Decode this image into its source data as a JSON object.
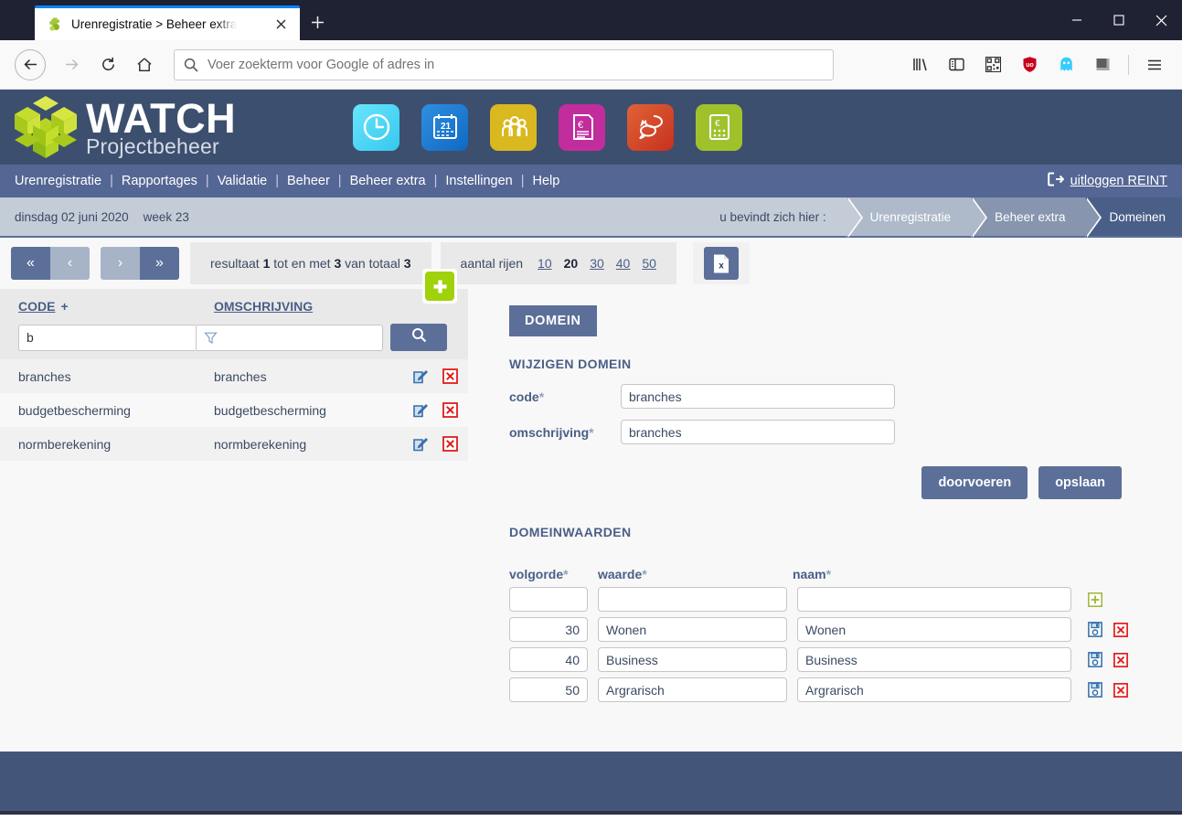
{
  "browser": {
    "tab": {
      "title": "Urenregistratie > Beheer extra",
      "favicon_icon": "puzzle-green-icon",
      "close_icon": "close-icon"
    },
    "new_tab_icon": "plus-icon",
    "window_controls": {
      "minimize": "minimize-icon",
      "maximize": "maximize-icon",
      "close": "close-icon"
    },
    "nav": {
      "back_icon": "arrow-left-icon",
      "forward_icon": "arrow-right-icon",
      "reload_icon": "reload-icon",
      "home_icon": "home-icon"
    },
    "urlbar": {
      "placeholder": "Voer zoekterm voor Google of adres in",
      "value": "",
      "search_icon": "search-icon"
    },
    "toolbar_icons": [
      "library-icon",
      "sidebar-icon",
      "qr-reader-icon",
      "ublock-shield-icon",
      "ghostery-icon",
      "color-swatch-icon",
      "hamburger-menu-icon"
    ]
  },
  "app": {
    "logo": {
      "title": "WATCH",
      "subtitle": "Projectbeheer",
      "mark_icon": "watch-cube-logo-icon"
    },
    "quick_icons": [
      {
        "name": "clock-icon",
        "color": "#4fd7f5"
      },
      {
        "name": "calendar-21-icon",
        "color": "#1b7fd4"
      },
      {
        "name": "people-icon",
        "color": "#d6b317"
      },
      {
        "name": "invoice-euro-icon",
        "color": "#bf2a9a"
      },
      {
        "name": "chat-bubbles-icon",
        "color": "#d1482a"
      },
      {
        "name": "calculator-euro-icon",
        "color": "#a5c62c"
      }
    ],
    "menu": {
      "items": [
        "Urenregistratie",
        "Rapportages",
        "Validatie",
        "Beheer",
        "Beheer extra",
        "Instellingen",
        "Help"
      ],
      "separator": "|",
      "logout": {
        "label": "uitloggen REINT",
        "icon": "logout-icon"
      }
    },
    "statusbar": {
      "date": "dinsdag 02 juni 2020",
      "week": "week 23",
      "here_label": "u bevindt zich hier :",
      "crumbs": [
        "Urenregistratie",
        "Beheer extra",
        "Domeinen"
      ]
    }
  },
  "toolbar": {
    "pager": [
      {
        "name": "first-page-button",
        "glyph": "«"
      },
      {
        "name": "prev-page-button",
        "glyph": "‹"
      },
      {
        "name": "next-page-button",
        "glyph": "›"
      },
      {
        "name": "last-page-button",
        "glyph": "»"
      }
    ],
    "result_prefix": "resultaat",
    "result_from": "1",
    "result_mid": "tot en met",
    "result_to": "3",
    "result_of": "van totaal",
    "result_total": "3",
    "rows_label": "aantal rijen",
    "rows_options": [
      "10",
      "20",
      "30",
      "40",
      "50"
    ],
    "rows_selected": "20",
    "export_icon": "excel-export-icon"
  },
  "table": {
    "add_icon": "add-plus-icon",
    "columns": [
      {
        "label": "CODE",
        "sort_marker": "+"
      },
      {
        "label": "OMSCHRIJVING",
        "sort_marker": ""
      }
    ],
    "filters": {
      "code_value": "b",
      "omschrijving_value": "",
      "funnel_icon": "funnel-icon",
      "search_icon": "search-icon"
    },
    "rows": [
      {
        "code": "branches",
        "omschrijving": "branches",
        "edit_icon": "edit-icon",
        "delete_icon": "delete-icon"
      },
      {
        "code": "budgetbescherming",
        "omschrijving": "budgetbescherming",
        "edit_icon": "edit-icon",
        "delete_icon": "delete-icon"
      },
      {
        "code": "normberekening",
        "omschrijving": "normberekening",
        "edit_icon": "edit-icon",
        "delete_icon": "delete-icon"
      }
    ]
  },
  "detail": {
    "tab_label": "DOMEIN",
    "heading": "WIJZIGEN DOMEIN",
    "fields": [
      {
        "label": "code",
        "required": "*",
        "value": "branches"
      },
      {
        "label": "omschrijving",
        "required": "*",
        "value": "branches"
      }
    ],
    "buttons": [
      {
        "name": "doorvoeren-button",
        "label": "doorvoeren"
      },
      {
        "name": "opslaan-button",
        "label": "opslaan"
      }
    ],
    "values_heading": "DOMEINWAARDEN",
    "values_columns": [
      {
        "label": "volgorde",
        "required": "*"
      },
      {
        "label": "waarde",
        "required": "*"
      },
      {
        "label": "naam",
        "required": "*"
      }
    ],
    "new_row": {
      "volgorde": "",
      "waarde": "",
      "naam": "",
      "add_icon": "add-row-icon"
    },
    "value_rows": [
      {
        "volgorde": "30",
        "waarde": "Wonen",
        "naam": "Wonen",
        "save_icon": "save-icon",
        "delete_icon": "delete-icon"
      },
      {
        "volgorde": "40",
        "waarde": "Business",
        "naam": "Business",
        "save_icon": "save-icon",
        "delete_icon": "delete-icon"
      },
      {
        "volgorde": "50",
        "waarde": "Argrarisch",
        "naam": "Argrarisch",
        "save_icon": "save-icon",
        "delete_icon": "delete-icon"
      }
    ]
  },
  "colors": {
    "header_bg": "#3d4f6f",
    "menu_bg": "#546694",
    "accent": "#5b6f99",
    "breadcrumb_bg": "#c4ccd8",
    "add_green": "#9fd20b",
    "delete_red": "#e01b1b",
    "footer_bg": "#44557a"
  }
}
